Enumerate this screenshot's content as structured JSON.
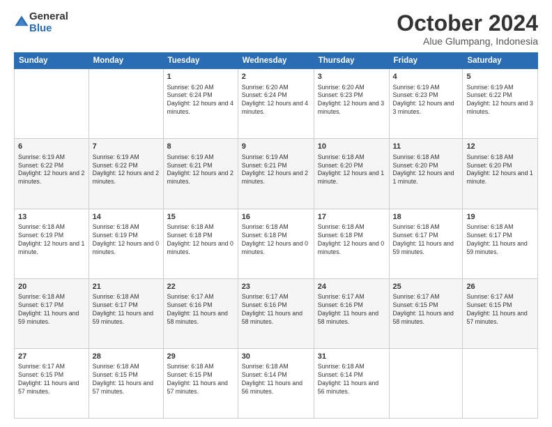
{
  "header": {
    "logo_general": "General",
    "logo_blue": "Blue",
    "month": "October 2024",
    "location": "Alue Glumpang, Indonesia"
  },
  "days_of_week": [
    "Sunday",
    "Monday",
    "Tuesday",
    "Wednesday",
    "Thursday",
    "Friday",
    "Saturday"
  ],
  "weeks": [
    [
      {
        "day": "",
        "info": ""
      },
      {
        "day": "",
        "info": ""
      },
      {
        "day": "1",
        "info": "Sunrise: 6:20 AM\nSunset: 6:24 PM\nDaylight: 12 hours and 4 minutes."
      },
      {
        "day": "2",
        "info": "Sunrise: 6:20 AM\nSunset: 6:24 PM\nDaylight: 12 hours and 4 minutes."
      },
      {
        "day": "3",
        "info": "Sunrise: 6:20 AM\nSunset: 6:23 PM\nDaylight: 12 hours and 3 minutes."
      },
      {
        "day": "4",
        "info": "Sunrise: 6:19 AM\nSunset: 6:23 PM\nDaylight: 12 hours and 3 minutes."
      },
      {
        "day": "5",
        "info": "Sunrise: 6:19 AM\nSunset: 6:22 PM\nDaylight: 12 hours and 3 minutes."
      }
    ],
    [
      {
        "day": "6",
        "info": "Sunrise: 6:19 AM\nSunset: 6:22 PM\nDaylight: 12 hours and 2 minutes."
      },
      {
        "day": "7",
        "info": "Sunrise: 6:19 AM\nSunset: 6:22 PM\nDaylight: 12 hours and 2 minutes."
      },
      {
        "day": "8",
        "info": "Sunrise: 6:19 AM\nSunset: 6:21 PM\nDaylight: 12 hours and 2 minutes."
      },
      {
        "day": "9",
        "info": "Sunrise: 6:19 AM\nSunset: 6:21 PM\nDaylight: 12 hours and 2 minutes."
      },
      {
        "day": "10",
        "info": "Sunrise: 6:18 AM\nSunset: 6:20 PM\nDaylight: 12 hours and 1 minute."
      },
      {
        "day": "11",
        "info": "Sunrise: 6:18 AM\nSunset: 6:20 PM\nDaylight: 12 hours and 1 minute."
      },
      {
        "day": "12",
        "info": "Sunrise: 6:18 AM\nSunset: 6:20 PM\nDaylight: 12 hours and 1 minute."
      }
    ],
    [
      {
        "day": "13",
        "info": "Sunrise: 6:18 AM\nSunset: 6:19 PM\nDaylight: 12 hours and 1 minute."
      },
      {
        "day": "14",
        "info": "Sunrise: 6:18 AM\nSunset: 6:19 PM\nDaylight: 12 hours and 0 minutes."
      },
      {
        "day": "15",
        "info": "Sunrise: 6:18 AM\nSunset: 6:18 PM\nDaylight: 12 hours and 0 minutes."
      },
      {
        "day": "16",
        "info": "Sunrise: 6:18 AM\nSunset: 6:18 PM\nDaylight: 12 hours and 0 minutes."
      },
      {
        "day": "17",
        "info": "Sunrise: 6:18 AM\nSunset: 6:18 PM\nDaylight: 12 hours and 0 minutes."
      },
      {
        "day": "18",
        "info": "Sunrise: 6:18 AM\nSunset: 6:17 PM\nDaylight: 11 hours and 59 minutes."
      },
      {
        "day": "19",
        "info": "Sunrise: 6:18 AM\nSunset: 6:17 PM\nDaylight: 11 hours and 59 minutes."
      }
    ],
    [
      {
        "day": "20",
        "info": "Sunrise: 6:18 AM\nSunset: 6:17 PM\nDaylight: 11 hours and 59 minutes."
      },
      {
        "day": "21",
        "info": "Sunrise: 6:18 AM\nSunset: 6:17 PM\nDaylight: 11 hours and 59 minutes."
      },
      {
        "day": "22",
        "info": "Sunrise: 6:17 AM\nSunset: 6:16 PM\nDaylight: 11 hours and 58 minutes."
      },
      {
        "day": "23",
        "info": "Sunrise: 6:17 AM\nSunset: 6:16 PM\nDaylight: 11 hours and 58 minutes."
      },
      {
        "day": "24",
        "info": "Sunrise: 6:17 AM\nSunset: 6:16 PM\nDaylight: 11 hours and 58 minutes."
      },
      {
        "day": "25",
        "info": "Sunrise: 6:17 AM\nSunset: 6:15 PM\nDaylight: 11 hours and 58 minutes."
      },
      {
        "day": "26",
        "info": "Sunrise: 6:17 AM\nSunset: 6:15 PM\nDaylight: 11 hours and 57 minutes."
      }
    ],
    [
      {
        "day": "27",
        "info": "Sunrise: 6:17 AM\nSunset: 6:15 PM\nDaylight: 11 hours and 57 minutes."
      },
      {
        "day": "28",
        "info": "Sunrise: 6:18 AM\nSunset: 6:15 PM\nDaylight: 11 hours and 57 minutes."
      },
      {
        "day": "29",
        "info": "Sunrise: 6:18 AM\nSunset: 6:15 PM\nDaylight: 11 hours and 57 minutes."
      },
      {
        "day": "30",
        "info": "Sunrise: 6:18 AM\nSunset: 6:14 PM\nDaylight: 11 hours and 56 minutes."
      },
      {
        "day": "31",
        "info": "Sunrise: 6:18 AM\nSunset: 6:14 PM\nDaylight: 11 hours and 56 minutes."
      },
      {
        "day": "",
        "info": ""
      },
      {
        "day": "",
        "info": ""
      }
    ]
  ]
}
